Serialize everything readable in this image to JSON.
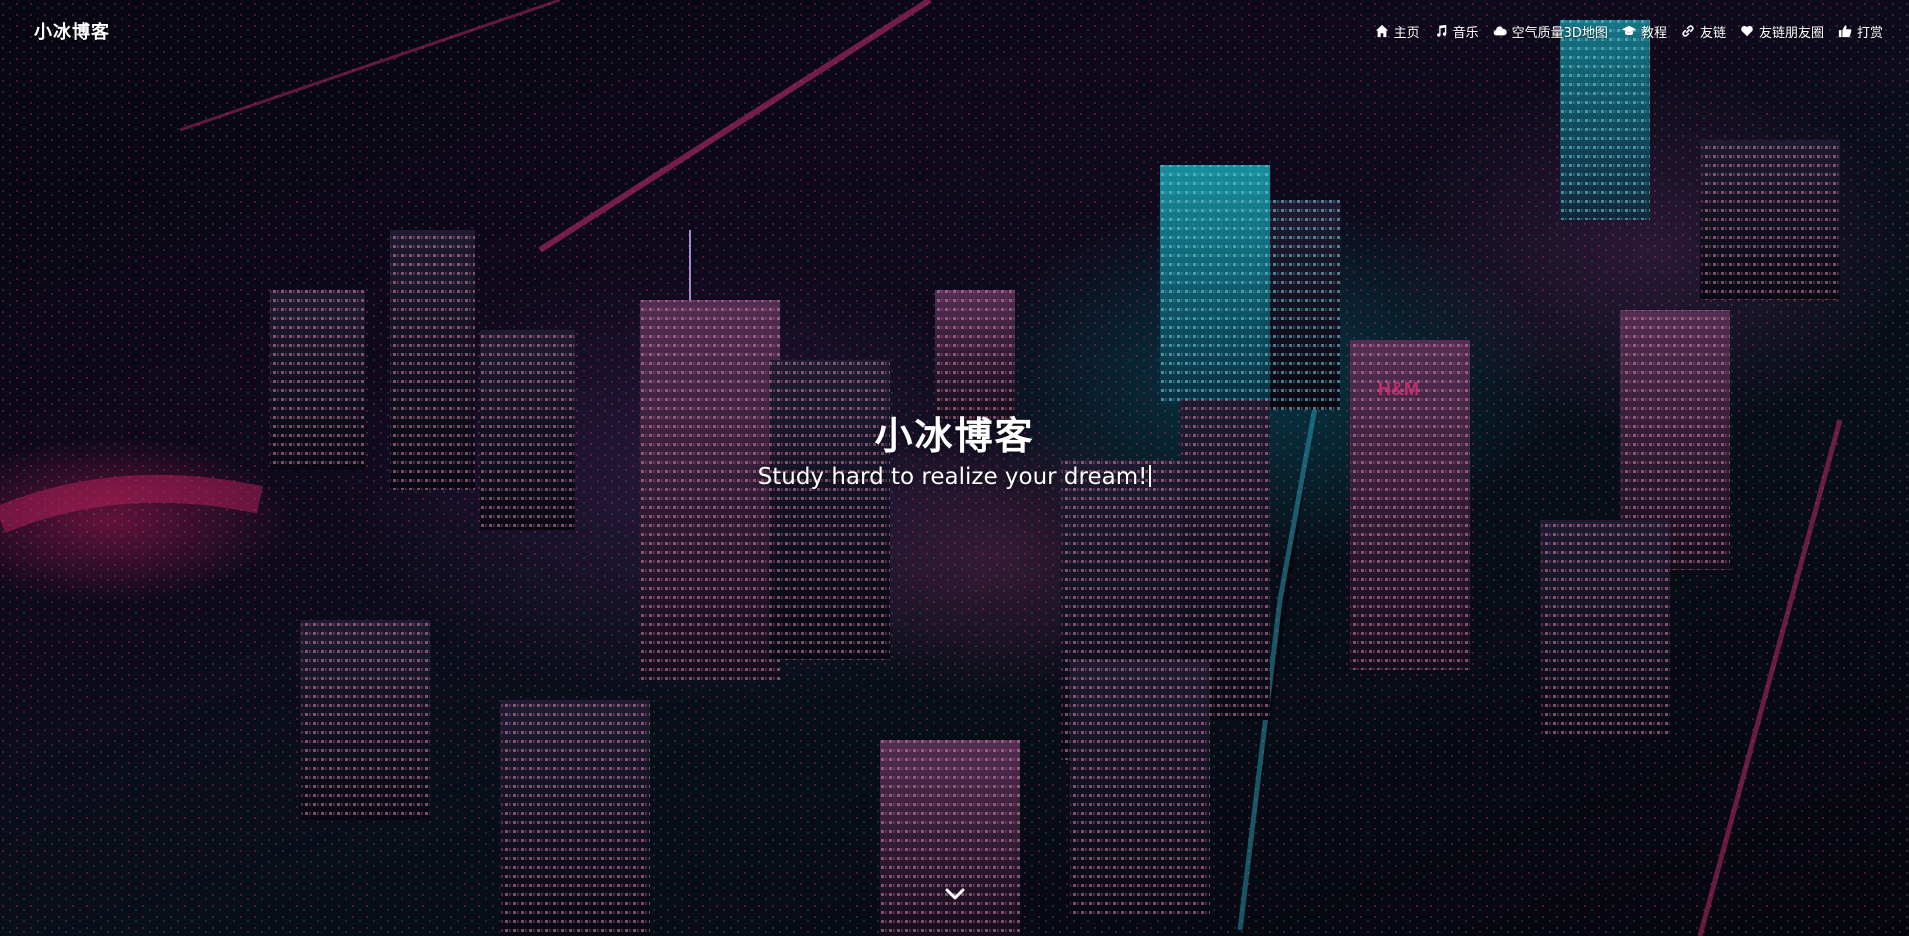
{
  "header": {
    "brand": "小冰博客"
  },
  "nav": {
    "items": [
      {
        "label": "主页",
        "icon": "home-icon"
      },
      {
        "label": "音乐",
        "icon": "music-icon"
      },
      {
        "label": "空气质量3D地图",
        "icon": "cloud-icon"
      },
      {
        "label": "教程",
        "icon": "graduation-cap-icon"
      },
      {
        "label": "友链",
        "icon": "link-icon"
      },
      {
        "label": "友链朋友圈",
        "icon": "heart-icon"
      },
      {
        "label": "打赏",
        "icon": "thumbs-up-icon"
      }
    ]
  },
  "hero": {
    "title": "小冰博客",
    "subtitle": "Study hard to realize your dream!"
  },
  "scroll": {
    "icon": "chevron-down-icon"
  },
  "colors": {
    "text": "#ffffff",
    "accent_cyan": "#00d2e6",
    "accent_pink": "#ff2d7a",
    "background": "#07060f"
  }
}
